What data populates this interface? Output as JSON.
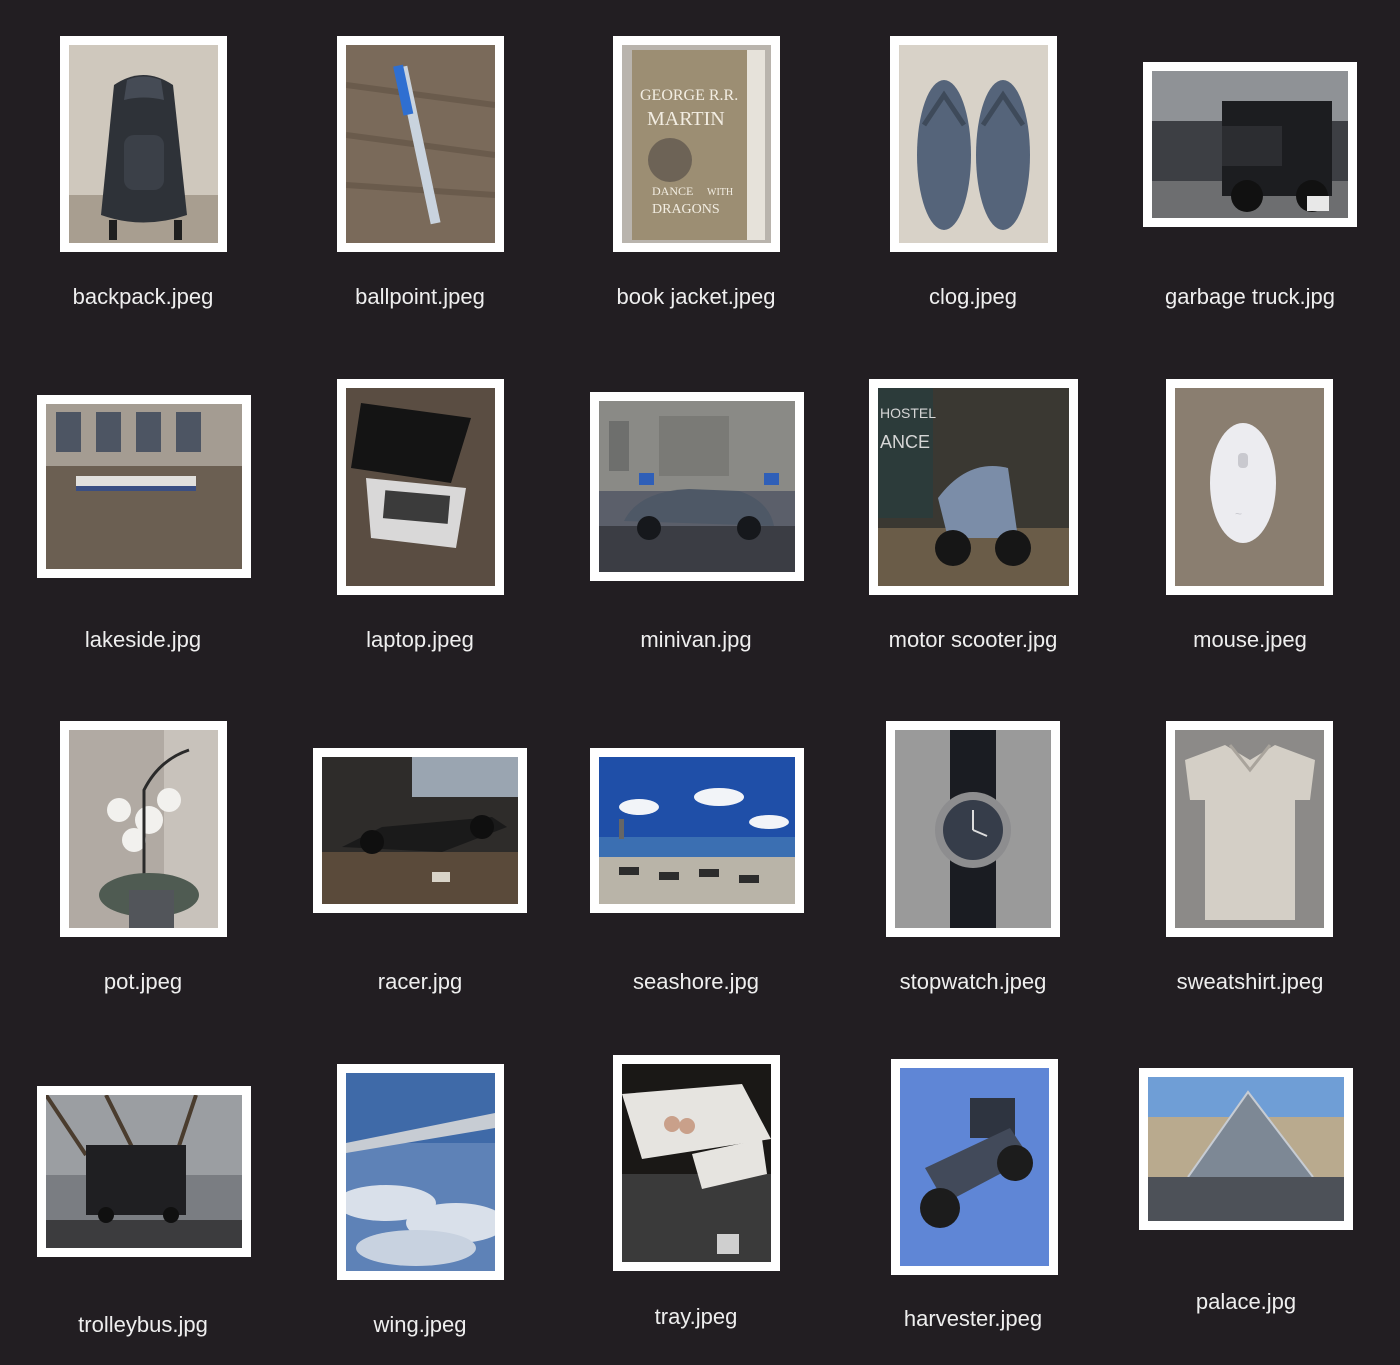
{
  "files": [
    {
      "name": "backpack.jpeg",
      "icon": "backpack-photo-thumbnail"
    },
    {
      "name": "ballpoint.jpeg",
      "icon": "ballpoint-pen-photo-thumbnail"
    },
    {
      "name": "book jacket.jpeg",
      "icon": "book-photo-thumbnail",
      "cover_text": [
        "GEORGE R.R.",
        "MARTIN",
        "DANCE",
        "WITH",
        "DRAGONS"
      ]
    },
    {
      "name": "clog.jpeg",
      "icon": "flip-flops-photo-thumbnail"
    },
    {
      "name": "garbage truck.jpg",
      "icon": "truck-photo-thumbnail"
    },
    {
      "name": "lakeside.jpg",
      "icon": "canal-boat-photo-thumbnail"
    },
    {
      "name": "laptop.jpeg",
      "icon": "laptop-photo-thumbnail"
    },
    {
      "name": "minivan.jpg",
      "icon": "car-photo-thumbnail"
    },
    {
      "name": "motor scooter.jpg",
      "icon": "scooter-photo-thumbnail",
      "sign_text": [
        "HOSTEL",
        "ANCE"
      ]
    },
    {
      "name": "mouse.jpeg",
      "icon": "mouse-photo-thumbnail"
    },
    {
      "name": "pot.jpeg",
      "icon": "orchid-pot-photo-thumbnail"
    },
    {
      "name": "racer.jpg",
      "icon": "race-car-photo-thumbnail"
    },
    {
      "name": "seashore.jpg",
      "icon": "beach-photo-thumbnail"
    },
    {
      "name": "stopwatch.jpeg",
      "icon": "watch-photo-thumbnail"
    },
    {
      "name": "sweatshirt.jpeg",
      "icon": "shirt-photo-thumbnail"
    },
    {
      "name": "trolleybus.jpg",
      "icon": "bus-photo-thumbnail"
    },
    {
      "name": "wing.jpeg",
      "icon": "airplane-wing-photo-thumbnail"
    },
    {
      "name": "tray.jpeg",
      "icon": "tray-photo-thumbnail"
    },
    {
      "name": "harvester.jpeg",
      "icon": "tractor-photo-thumbnail"
    },
    {
      "name": "palace.jpg",
      "icon": "pyramid-photo-thumbnail"
    }
  ],
  "colors": {
    "background": "#221e22",
    "thumbnail_border": "#ffffff",
    "label_text": "#eeeeee"
  }
}
